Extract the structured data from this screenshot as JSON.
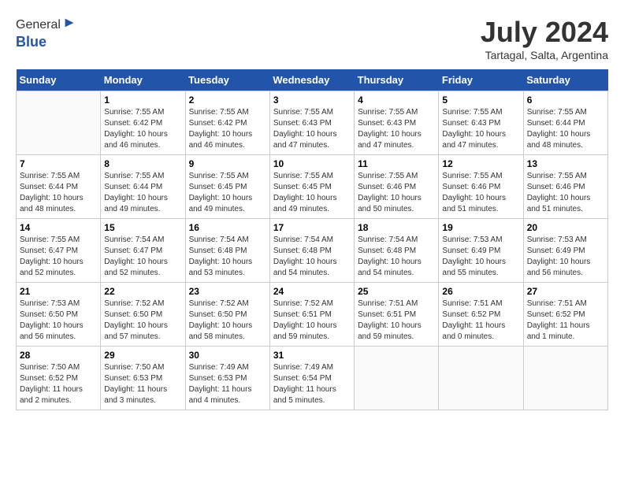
{
  "header": {
    "logo_general": "General",
    "logo_blue": "Blue",
    "month_year": "July 2024",
    "location": "Tartagal, Salta, Argentina"
  },
  "days_of_week": [
    "Sunday",
    "Monday",
    "Tuesday",
    "Wednesday",
    "Thursday",
    "Friday",
    "Saturday"
  ],
  "weeks": [
    [
      {
        "day": "",
        "info": ""
      },
      {
        "day": "1",
        "info": "Sunrise: 7:55 AM\nSunset: 6:42 PM\nDaylight: 10 hours\nand 46 minutes."
      },
      {
        "day": "2",
        "info": "Sunrise: 7:55 AM\nSunset: 6:42 PM\nDaylight: 10 hours\nand 46 minutes."
      },
      {
        "day": "3",
        "info": "Sunrise: 7:55 AM\nSunset: 6:43 PM\nDaylight: 10 hours\nand 47 minutes."
      },
      {
        "day": "4",
        "info": "Sunrise: 7:55 AM\nSunset: 6:43 PM\nDaylight: 10 hours\nand 47 minutes."
      },
      {
        "day": "5",
        "info": "Sunrise: 7:55 AM\nSunset: 6:43 PM\nDaylight: 10 hours\nand 47 minutes."
      },
      {
        "day": "6",
        "info": "Sunrise: 7:55 AM\nSunset: 6:44 PM\nDaylight: 10 hours\nand 48 minutes."
      }
    ],
    [
      {
        "day": "7",
        "info": "Sunrise: 7:55 AM\nSunset: 6:44 PM\nDaylight: 10 hours\nand 48 minutes."
      },
      {
        "day": "8",
        "info": "Sunrise: 7:55 AM\nSunset: 6:44 PM\nDaylight: 10 hours\nand 49 minutes."
      },
      {
        "day": "9",
        "info": "Sunrise: 7:55 AM\nSunset: 6:45 PM\nDaylight: 10 hours\nand 49 minutes."
      },
      {
        "day": "10",
        "info": "Sunrise: 7:55 AM\nSunset: 6:45 PM\nDaylight: 10 hours\nand 49 minutes."
      },
      {
        "day": "11",
        "info": "Sunrise: 7:55 AM\nSunset: 6:46 PM\nDaylight: 10 hours\nand 50 minutes."
      },
      {
        "day": "12",
        "info": "Sunrise: 7:55 AM\nSunset: 6:46 PM\nDaylight: 10 hours\nand 51 minutes."
      },
      {
        "day": "13",
        "info": "Sunrise: 7:55 AM\nSunset: 6:46 PM\nDaylight: 10 hours\nand 51 minutes."
      }
    ],
    [
      {
        "day": "14",
        "info": "Sunrise: 7:55 AM\nSunset: 6:47 PM\nDaylight: 10 hours\nand 52 minutes."
      },
      {
        "day": "15",
        "info": "Sunrise: 7:54 AM\nSunset: 6:47 PM\nDaylight: 10 hours\nand 52 minutes."
      },
      {
        "day": "16",
        "info": "Sunrise: 7:54 AM\nSunset: 6:48 PM\nDaylight: 10 hours\nand 53 minutes."
      },
      {
        "day": "17",
        "info": "Sunrise: 7:54 AM\nSunset: 6:48 PM\nDaylight: 10 hours\nand 54 minutes."
      },
      {
        "day": "18",
        "info": "Sunrise: 7:54 AM\nSunset: 6:48 PM\nDaylight: 10 hours\nand 54 minutes."
      },
      {
        "day": "19",
        "info": "Sunrise: 7:53 AM\nSunset: 6:49 PM\nDaylight: 10 hours\nand 55 minutes."
      },
      {
        "day": "20",
        "info": "Sunrise: 7:53 AM\nSunset: 6:49 PM\nDaylight: 10 hours\nand 56 minutes."
      }
    ],
    [
      {
        "day": "21",
        "info": "Sunrise: 7:53 AM\nSunset: 6:50 PM\nDaylight: 10 hours\nand 56 minutes."
      },
      {
        "day": "22",
        "info": "Sunrise: 7:52 AM\nSunset: 6:50 PM\nDaylight: 10 hours\nand 57 minutes."
      },
      {
        "day": "23",
        "info": "Sunrise: 7:52 AM\nSunset: 6:50 PM\nDaylight: 10 hours\nand 58 minutes."
      },
      {
        "day": "24",
        "info": "Sunrise: 7:52 AM\nSunset: 6:51 PM\nDaylight: 10 hours\nand 59 minutes."
      },
      {
        "day": "25",
        "info": "Sunrise: 7:51 AM\nSunset: 6:51 PM\nDaylight: 10 hours\nand 59 minutes."
      },
      {
        "day": "26",
        "info": "Sunrise: 7:51 AM\nSunset: 6:52 PM\nDaylight: 11 hours\nand 0 minutes."
      },
      {
        "day": "27",
        "info": "Sunrise: 7:51 AM\nSunset: 6:52 PM\nDaylight: 11 hours\nand 1 minute."
      }
    ],
    [
      {
        "day": "28",
        "info": "Sunrise: 7:50 AM\nSunset: 6:52 PM\nDaylight: 11 hours\nand 2 minutes."
      },
      {
        "day": "29",
        "info": "Sunrise: 7:50 AM\nSunset: 6:53 PM\nDaylight: 11 hours\nand 3 minutes."
      },
      {
        "day": "30",
        "info": "Sunrise: 7:49 AM\nSunset: 6:53 PM\nDaylight: 11 hours\nand 4 minutes."
      },
      {
        "day": "31",
        "info": "Sunrise: 7:49 AM\nSunset: 6:54 PM\nDaylight: 11 hours\nand 5 minutes."
      },
      {
        "day": "",
        "info": ""
      },
      {
        "day": "",
        "info": ""
      },
      {
        "day": "",
        "info": ""
      }
    ]
  ]
}
